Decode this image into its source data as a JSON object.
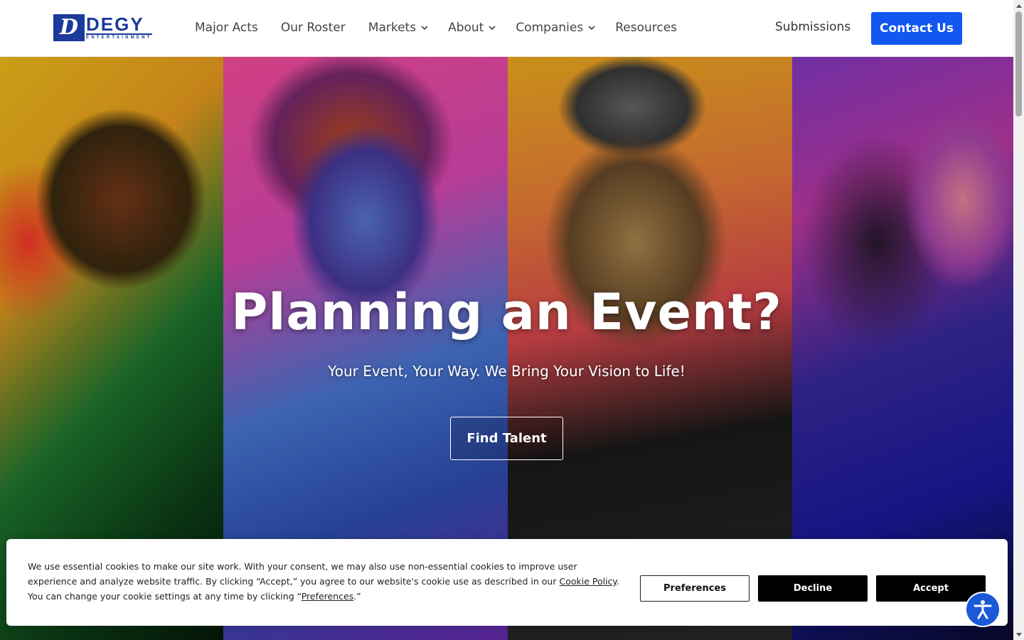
{
  "header": {
    "logo": {
      "mark": "D",
      "word": "DEGY",
      "sub": "ENTERTAINMENT"
    },
    "nav": [
      {
        "label": "Major Acts",
        "dropdown": false
      },
      {
        "label": "Our Roster",
        "dropdown": false
      },
      {
        "label": "Markets",
        "dropdown": true
      },
      {
        "label": "About",
        "dropdown": true
      },
      {
        "label": "Companies",
        "dropdown": true
      },
      {
        "label": "Resources",
        "dropdown": false
      }
    ],
    "submissions_label": "Submissions",
    "contact_label": "Contact Us",
    "accent_color": "#1257f0"
  },
  "hero": {
    "title": "Planning an Event?",
    "subtitle": "Your Event, Your Way. We Bring Your Vision to Life!",
    "cta_label": "Find Talent"
  },
  "cookie_banner": {
    "text_before_link": "We use essential cookies to make our site work. With your consent, we may also use non-essential cookies to improve user experience and analyze website traffic. By clicking “Accept,” you agree to our website's cookie use as described in our ",
    "cookie_policy_link": "Cookie Policy",
    "text_middle": ". You can change your cookie settings at any time by clicking “",
    "preferences_link": "Preferences",
    "text_end": ".”",
    "buttons": {
      "preferences": "Preferences",
      "decline": "Decline",
      "accept": "Accept"
    }
  },
  "accessibility_button": {
    "icon": "accessibility-icon"
  }
}
